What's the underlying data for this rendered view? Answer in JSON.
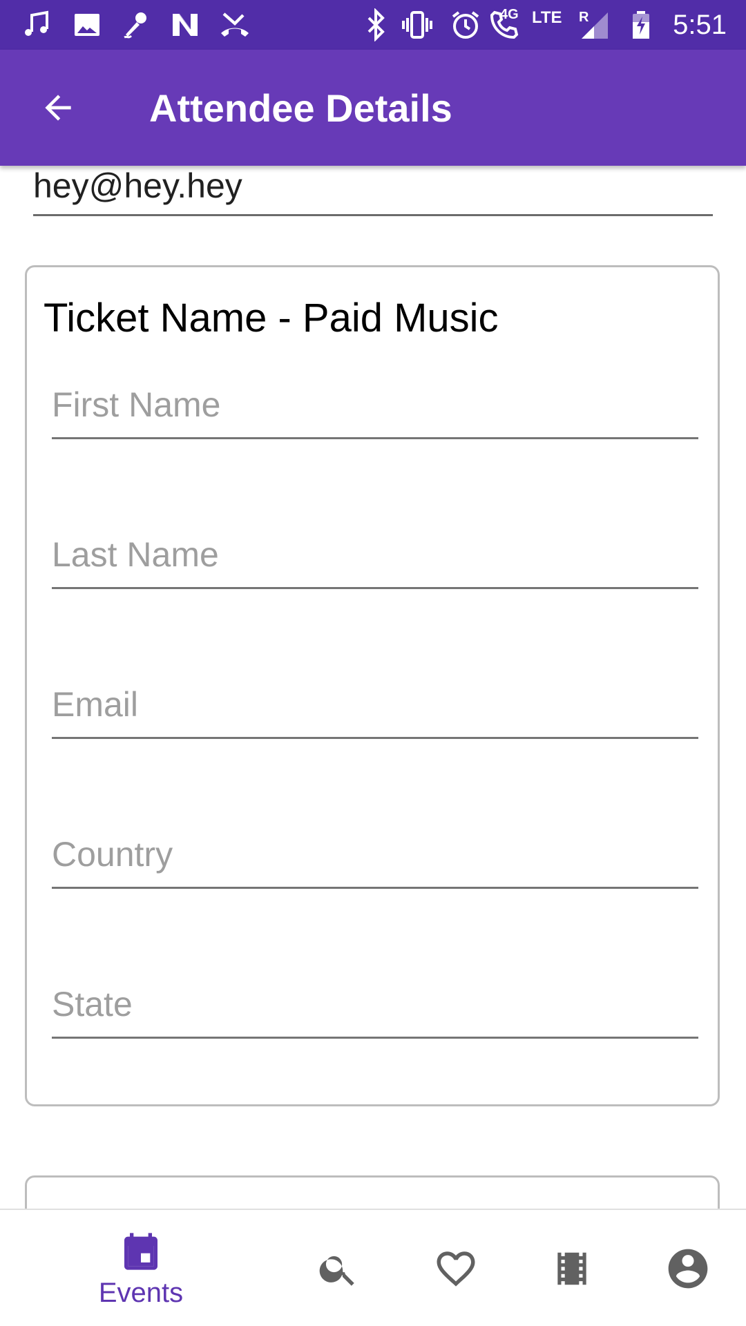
{
  "status_bar": {
    "time": "5:51",
    "network_label": "4G",
    "lte_label": "LTE",
    "roaming_label": "R",
    "left_icons": [
      "music-note-icon",
      "image-icon",
      "microphone-icon",
      "n-app-icon",
      "missed-call-icon"
    ],
    "right_icons": [
      "bluetooth-icon",
      "vibrate-icon",
      "alarm-icon",
      "wifi-calling-icon",
      "signal-icon",
      "battery-charging-icon"
    ]
  },
  "app_bar": {
    "title": "Attendee Details",
    "back_icon": "arrow-back-icon",
    "background": "#673ab7",
    "status_background": "#512da8"
  },
  "form": {
    "previous_email_value": "hey@hey.hey",
    "ticket_title": "Ticket Name - Paid Music",
    "fields": [
      {
        "placeholder": "First Name"
      },
      {
        "placeholder": "Last Name"
      },
      {
        "placeholder": "Email"
      },
      {
        "placeholder": "Country"
      },
      {
        "placeholder": "State"
      }
    ]
  },
  "bottom_nav": {
    "items": [
      {
        "label": "Events",
        "icon": "calendar-icon",
        "active": true
      },
      {
        "label": "",
        "icon": "search-icon",
        "active": false
      },
      {
        "label": "",
        "icon": "heart-icon",
        "active": false
      },
      {
        "label": "",
        "icon": "film-icon",
        "active": false
      },
      {
        "label": "",
        "icon": "account-icon",
        "active": false
      }
    ],
    "active_color": "#5e35b1",
    "inactive_color": "#616161"
  }
}
